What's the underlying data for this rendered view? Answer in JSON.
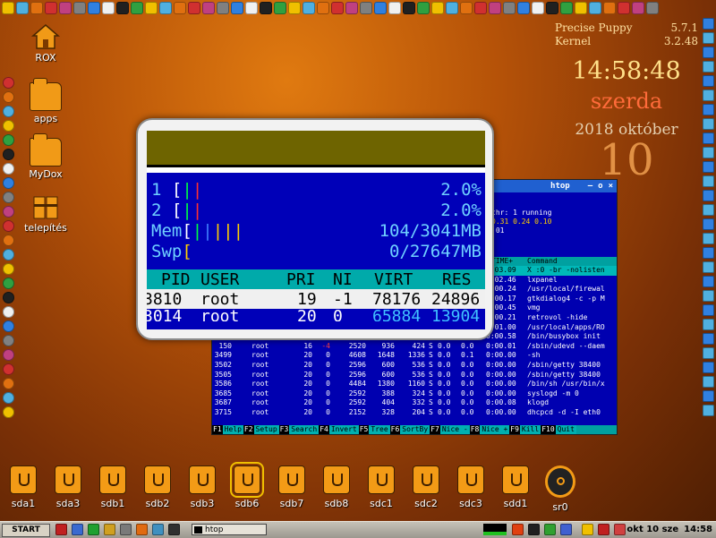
{
  "desktop_icons": [
    "ROX",
    "apps",
    "MyDox",
    "telepítés"
  ],
  "conky": {
    "distro_label": "Precise Puppy",
    "distro_version": "5.7.1",
    "kernel_label": "Kernel",
    "kernel_version": "3.2.48",
    "time": "14:58:48",
    "weekday": "szerda",
    "year_month": "2018 október",
    "day": "10"
  },
  "htop": {
    "title": "htop",
    "title_controls": [
      "–",
      "o",
      "×"
    ],
    "thr_line": "thr: 1 running",
    "load_line": "0.31 0.24 0.10",
    "uptime_frag": ":01",
    "header": {
      "time": "TIME+",
      "command": "Command"
    },
    "top_rows": [
      [
        "0:03.09",
        "X :0 -br -nolisten"
      ],
      [
        "0:02.46",
        "lxpanel"
      ],
      [
        "0:00.24",
        "/usr/local/firewal"
      ],
      [
        "0:00.17",
        "gtkdialog4 -c -p M"
      ],
      [
        "0:00.45",
        "vmg"
      ],
      [
        "0:00.21",
        "retrovol -hide"
      ],
      [
        "0:01.00",
        "/usr/local/apps/RO"
      ]
    ],
    "rows": [
      {
        "pid": "",
        "user": "",
        "pri": "",
        "ni": "",
        "virt": "",
        "res": "",
        "shr": "",
        "s": "",
        "cpu": "0.0",
        "mem": "0.0",
        "time": "0:00.58",
        "cmd": "/bin/busybox init"
      },
      {
        "pid": "150",
        "user": "root",
        "pri": "16",
        "ni": "-4",
        "virt": "2520",
        "res": "936",
        "shr": "424",
        "s": "S",
        "cpu": "0.0",
        "mem": "0.0",
        "time": "0:00.01",
        "cmd": "/sbin/udevd --daem"
      },
      {
        "pid": "3499",
        "user": "root",
        "pri": "20",
        "ni": "0",
        "virt": "4608",
        "res": "1648",
        "shr": "1336",
        "s": "S",
        "cpu": "0.0",
        "mem": "0.1",
        "time": "0:00.00",
        "cmd": "-sh"
      },
      {
        "pid": "3502",
        "user": "root",
        "pri": "20",
        "ni": "0",
        "virt": "2596",
        "res": "600",
        "shr": "536",
        "s": "S",
        "cpu": "0.0",
        "mem": "0.0",
        "time": "0:00.00",
        "cmd": "/sbin/getty 38400"
      },
      {
        "pid": "3505",
        "user": "root",
        "pri": "20",
        "ni": "0",
        "virt": "2596",
        "res": "600",
        "shr": "536",
        "s": "S",
        "cpu": "0.0",
        "mem": "0.0",
        "time": "0:00.00",
        "cmd": "/sbin/getty 38400"
      },
      {
        "pid": "3586",
        "user": "root",
        "pri": "20",
        "ni": "0",
        "virt": "4484",
        "res": "1380",
        "shr": "1160",
        "s": "S",
        "cpu": "0.0",
        "mem": "0.0",
        "time": "0:00.00",
        "cmd": "/bin/sh /usr/bin/x"
      },
      {
        "pid": "3685",
        "user": "root",
        "pri": "20",
        "ni": "0",
        "virt": "2592",
        "res": "388",
        "shr": "324",
        "s": "S",
        "cpu": "0.0",
        "mem": "0.0",
        "time": "0:00.00",
        "cmd": "syslogd -m 0"
      },
      {
        "pid": "3687",
        "user": "root",
        "pri": "20",
        "ni": "0",
        "virt": "2592",
        "res": "404",
        "shr": "332",
        "s": "S",
        "cpu": "0.0",
        "mem": "0.0",
        "time": "0:00.08",
        "cmd": "klogd"
      },
      {
        "pid": "3715",
        "user": "root",
        "pri": "20",
        "ni": "0",
        "virt": "2152",
        "res": "328",
        "shr": "204",
        "s": "S",
        "cpu": "0.0",
        "mem": "0.0",
        "time": "0:00.00",
        "cmd": "dhcpcd -d -I  eth0"
      }
    ],
    "fkeys": [
      {
        "key": "F1",
        "label": "Help"
      },
      {
        "key": "F2",
        "label": "Setup"
      },
      {
        "key": "F3",
        "label": "Search"
      },
      {
        "key": "F4",
        "label": "Invert"
      },
      {
        "key": "F5",
        "label": "Tree"
      },
      {
        "key": "F6",
        "label": "SortBy"
      },
      {
        "key": "F7",
        "label": "Nice -"
      },
      {
        "key": "F8",
        "label": "Nice +"
      },
      {
        "key": "F9",
        "label": "Kill"
      },
      {
        "key": "F10",
        "label": "Quit"
      }
    ]
  },
  "magnifier": {
    "meters": [
      {
        "label": "1",
        "value": "2.0%"
      },
      {
        "label": "2",
        "value": "2.0%"
      },
      {
        "label": "Mem",
        "value": "104/3041MB"
      },
      {
        "label": "Swp",
        "value": "0/27647MB"
      }
    ],
    "header": [
      "PID",
      "USER",
      "PRI",
      "NI",
      "VIRT",
      "RES"
    ],
    "selected_row": [
      "3810",
      "root",
      "19",
      "-1",
      "78176",
      "24896"
    ],
    "next_row": [
      "3014",
      "root",
      "20",
      "0",
      "65884",
      "13904"
    ]
  },
  "drives": [
    "sda1",
    "sda3",
    "sdb1",
    "sdb2",
    "sdb3",
    "sdb6",
    "sdb7",
    "sdb8",
    "sdc1",
    "sdc2",
    "sdc3",
    "sdd1",
    "sr0"
  ],
  "taskbar": {
    "start_label": "START",
    "task_label": "htop",
    "tray_date": "okt 10 sze",
    "tray_time": "14:58"
  },
  "colors": {
    "htop_bg": "#0000b0",
    "htop_header": "#00a0a0",
    "accent_orange": "#f39b16"
  }
}
